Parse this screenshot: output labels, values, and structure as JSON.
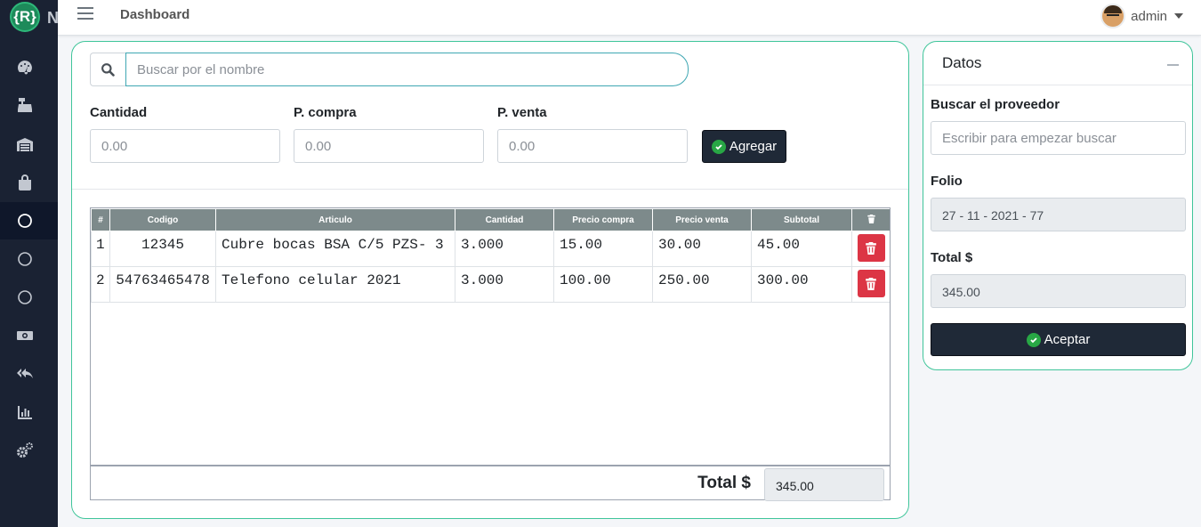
{
  "brand": {
    "logo_text": "{R}",
    "name": "N"
  },
  "topbar": {
    "title": "Dashboard",
    "user": "admin"
  },
  "sidebar": {
    "items": [
      {
        "icon": "tachometer-icon"
      },
      {
        "icon": "cash-register-icon"
      },
      {
        "icon": "warehouse-icon"
      },
      {
        "icon": "shopping-bag-icon"
      },
      {
        "icon": "circle-icon",
        "active": true
      },
      {
        "icon": "circle-icon"
      },
      {
        "icon": "circle-icon"
      },
      {
        "icon": "money-bill-icon"
      },
      {
        "icon": "reply-all-icon"
      },
      {
        "icon": "chart-bar-icon"
      },
      {
        "icon": "cogs-icon"
      }
    ]
  },
  "form": {
    "search_placeholder": "Buscar por el nombre",
    "cantidad_label": "Cantidad",
    "compra_label": "P. compra",
    "venta_label": "P. venta",
    "cantidad_placeholder": "0.00",
    "compra_placeholder": "0.00",
    "venta_placeholder": "0.00",
    "agregar_label": "Agregar"
  },
  "table": {
    "headers": [
      "#",
      "Codigo",
      "Articulo",
      "Cantidad",
      "Precio compra",
      "Precio venta",
      "Subtotal"
    ],
    "rows": [
      {
        "num": "1",
        "codigo": "12345",
        "articulo": "Cubre bocas BSA C/5 PZS- 3",
        "cantidad": "3.000",
        "precio_compra": "15.00",
        "precio_venta": "30.00",
        "subtotal": "45.00"
      },
      {
        "num": "2",
        "codigo": "54763465478",
        "articulo": "Telefono celular 2021",
        "cantidad": "3.000",
        "precio_compra": "100.00",
        "precio_venta": "250.00",
        "subtotal": "300.00"
      }
    ],
    "total_label": "Total $",
    "total_value": "345.00"
  },
  "side": {
    "title": "Datos",
    "proveedor_label": "Buscar el proveedor",
    "proveedor_placeholder": "Escribir para empezar buscar",
    "folio_label": "Folio",
    "folio_value": "27 - 11 - 2021 - 77",
    "total_label": "Total $",
    "total_value": "345.00",
    "aceptar_label": "Aceptar"
  },
  "colors": {
    "sidebar_bg": "#1a2233",
    "card_border": "#3fc59a",
    "table_header": "#7d8a8b",
    "danger": "#dc3545",
    "dark_button": "#1f2937",
    "success": "#28a745"
  }
}
